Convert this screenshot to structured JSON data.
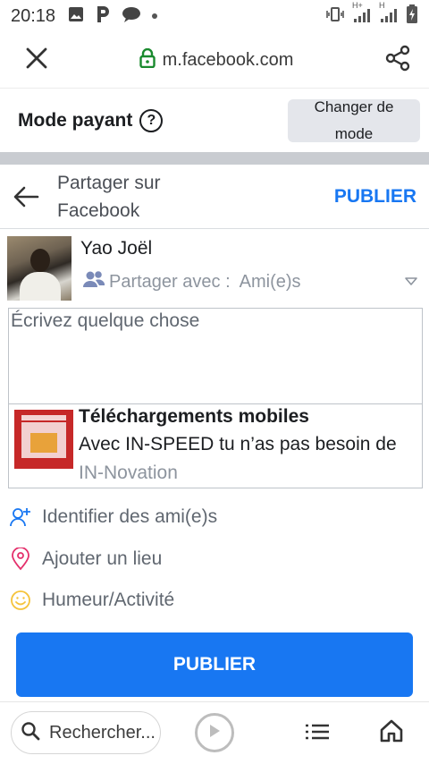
{
  "status_bar": {
    "time": "20:18",
    "net_label_1": "H+",
    "net_label_2": "H"
  },
  "browser": {
    "url": "m.facebook.com"
  },
  "mode_banner": {
    "label": "Mode payant",
    "help_symbol": "?",
    "change_line1": "Changer de",
    "change_line2": "mode"
  },
  "share_header": {
    "title_line1": "Partager sur",
    "title_line2": "Facebook",
    "publish_label": "PUBLIER"
  },
  "user": {
    "name": "Yao Joël",
    "share_with_label": "Partager avec :",
    "share_with_value": "Ami(e)s"
  },
  "composer": {
    "placeholder": "Écrivez quelque chose"
  },
  "link_preview": {
    "title": "Téléchargements mobiles",
    "description": "Avec IN-SPEED tu n’as pas besoin de",
    "source": "IN-Novation"
  },
  "options": [
    {
      "label": "Identifier des ami(e)s",
      "icon": "tag-friends-icon"
    },
    {
      "label": "Ajouter un lieu",
      "icon": "location-pin-icon"
    },
    {
      "label": "Humeur/Activité",
      "icon": "smiley-icon"
    }
  ],
  "publish_button": {
    "label": "PUBLIER"
  },
  "bottom_bar": {
    "search_label": "Rechercher..."
  },
  "colors": {
    "facebook_blue": "#1877f2",
    "location_pink": "#e4306c",
    "smiley_yellow": "#f5c33b",
    "tag_blue": "#1877f2"
  }
}
